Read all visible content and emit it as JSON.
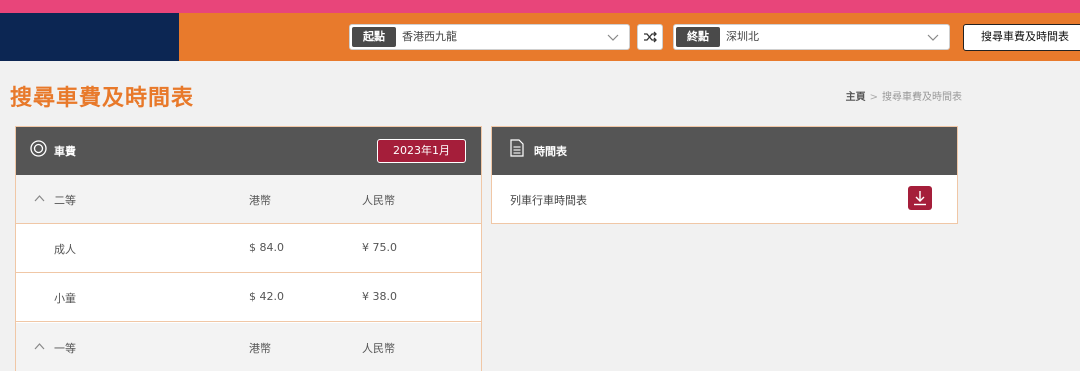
{
  "header": {
    "from_tag": "起點",
    "from_value": "香港西九龍",
    "to_tag": "終點",
    "to_value": "深圳北",
    "search_label": "搜尋車費及時間表"
  },
  "page": {
    "title": "搜尋車費及時間表",
    "breadcrumb": {
      "home": "主頁",
      "sep": ">",
      "current": "搜尋車費及時間表"
    }
  },
  "fare": {
    "title": "車費",
    "date": "2023年1月",
    "sections": [
      {
        "class": "二等",
        "col_hkd": "港幣",
        "col_rmb": "人民幣",
        "rows": [
          {
            "type": "成人",
            "hkd": "$ 84.0",
            "rmb": "¥ 75.0"
          },
          {
            "type": "小童",
            "hkd": "$ 42.0",
            "rmb": "¥ 38.0"
          }
        ]
      },
      {
        "class": "一等",
        "col_hkd": "港幣",
        "col_rmb": "人民幣"
      }
    ]
  },
  "timetable": {
    "title": "時間表",
    "item_label": "列車行車時間表"
  },
  "colors": {
    "accent_orange": "#e87a2c",
    "top_pink": "#e8457a",
    "navy": "#0c2653",
    "burgundy": "#a51e3a",
    "panel_head": "#555555"
  }
}
